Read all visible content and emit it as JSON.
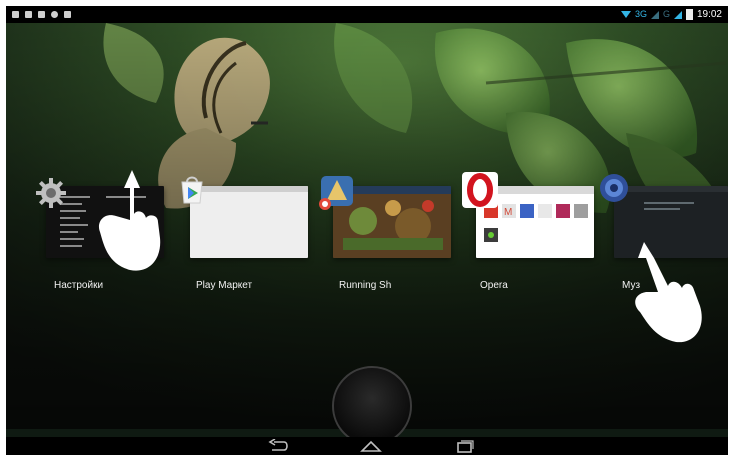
{
  "status_bar": {
    "network": "3G",
    "network2": "G",
    "time": "19:02",
    "left_icons": [
      "usb-icon",
      "android-icon",
      "gallery-icon",
      "search-icon",
      "storage-icon"
    ]
  },
  "recents": [
    {
      "label": "Настройки",
      "icon": "settings-icon"
    },
    {
      "label": "Play Маркет",
      "icon": "play-store-icon"
    },
    {
      "label": "Running Sh",
      "icon": "running-shadow-icon"
    },
    {
      "label": "Opera",
      "icon": "opera-icon"
    },
    {
      "label": "Муз",
      "icon": "music-icon"
    }
  ],
  "nav": {
    "back": "back-icon",
    "home": "home-icon",
    "recents": "recent-apps-icon"
  },
  "colors": {
    "accent": "#33b5e5",
    "opera": "#d2141f",
    "play": "#34a853"
  }
}
